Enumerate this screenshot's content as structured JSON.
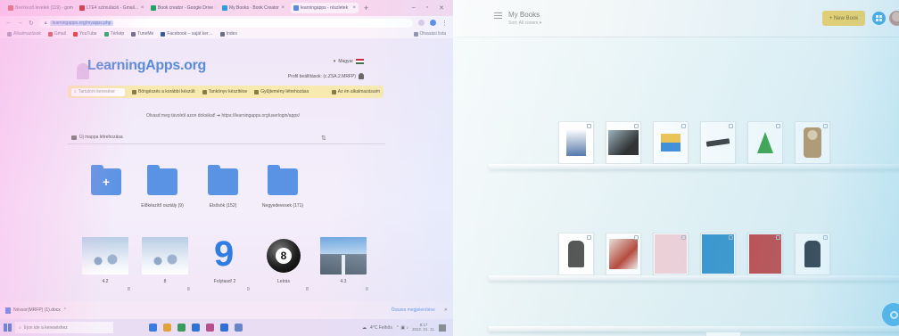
{
  "browser": {
    "tabs": [
      {
        "label": "Beérkező levelek (119) - gom…",
        "favicon_color": "#d44638",
        "active": false
      },
      {
        "label": "LTE4 szimuláció - Gmail…",
        "favicon_color": "#c5221f",
        "active": false
      },
      {
        "label": "Book creator - Google Drive",
        "favicon_color": "#1fa463",
        "active": false
      },
      {
        "label": "My Books · Book Creator",
        "favicon_color": "#2d9de0",
        "active": false
      },
      {
        "label": "learningapps - részletek",
        "favicon_color": "#5a8bd8",
        "active": true
      }
    ],
    "new_tab": "+",
    "window_controls": [
      "–",
      "▫",
      "✕"
    ],
    "url": "learningapps.org/myapps.php",
    "bookmarks": [
      {
        "label": "Alkalmazások",
        "color": "#8a8aa6"
      },
      {
        "label": "Gmail",
        "color": "#d44638"
      },
      {
        "label": "YouTube",
        "color": "#e62117"
      },
      {
        "label": "Térkép",
        "color": "#1fa463"
      },
      {
        "label": "TuneMe",
        "color": "#6d6d8c"
      },
      {
        "label": "Facebook – saját ker…",
        "color": "#3b5998"
      },
      {
        "label": "Index",
        "color": "#6d6d8c"
      }
    ],
    "bookmarks_right": "Olvasási lista"
  },
  "site": {
    "logo": "LearningApps.org",
    "language": "Magyar",
    "username": "Profil beállítások: (c.ZSA.2.MRFP)",
    "search_placeholder": "Tartalom keresése",
    "nav": [
      "Böngészés a korábbi készült",
      "Tankönyv készítése",
      "Gyűjtemény létrehozása"
    ],
    "nav_right": "Az én alkalmazásaim",
    "notice": "Olvasd meg távolról azon doksikat! ➔ https://learningapps.org/userlogin/apps/",
    "new_folder": "Új mappa létrehozása",
    "sort_icon": "⇅",
    "folders": [
      {
        "label": "",
        "plus": "+"
      },
      {
        "label": "Előkészítő osztály (9)",
        "plus": ""
      },
      {
        "label": "Elsősök (152)",
        "plus": ""
      },
      {
        "label": "Negyedevesek (171)",
        "plus": ""
      }
    ],
    "apps": [
      {
        "label": "4.2",
        "count": "8"
      },
      {
        "label": "8",
        "count": "8"
      },
      {
        "label": "Folytasd! 2",
        "count": "9",
        "number": "9"
      },
      {
        "label": "Leírás",
        "count": "8",
        "number": "8"
      },
      {
        "label": "4.3",
        "count": "8"
      }
    ]
  },
  "downloads": {
    "file": "Névsor(MRFP) (1).docx",
    "show_all": "Összes megjelenítése"
  },
  "taskbar": {
    "search_placeholder": "Írjon ide a kereséshez",
    "weather": "4°C Felhős",
    "time": "8:17",
    "date": "2022. 01. 11."
  },
  "bookcreator": {
    "title": "My Books",
    "subtitle": "Sort: All covers ▾",
    "new_book": "+ New Book",
    "shelves": [
      {
        "books": [
          {
            "cover": "soccer",
            "colors": [
              "#ffffff",
              "#5577aa"
            ]
          },
          {
            "cover": "screen",
            "colors": [
              "#9fb4be",
              "#2b2b2b"
            ]
          },
          {
            "cover": "cartoon",
            "colors": [
              "#f1c24a",
              "#3b8ad8"
            ]
          },
          {
            "cover": "gun",
            "colors": [
              "#ffffff",
              "#333333"
            ]
          },
          {
            "cover": "tree",
            "colors": [
              "#ffffff",
              "#2f9d3a"
            ]
          },
          {
            "cover": "woman",
            "colors": [
              "#ffffff",
              "#b68a55"
            ]
          }
        ]
      },
      {
        "books": [
          {
            "cover": "coat",
            "colors": [
              "#ffffff",
              "#555555"
            ]
          },
          {
            "cover": "collage",
            "colors": [
              "#e9e1d8",
              "#b84233"
            ]
          },
          {
            "cover": "pink",
            "colors": [
              "#f5d0d6",
              "#f5d0d6"
            ]
          },
          {
            "cover": "blue",
            "colors": [
              "#2c8ec9",
              "#2c8ec9"
            ]
          },
          {
            "cover": "red",
            "colors": [
              "#c03838",
              "#c03838"
            ]
          },
          {
            "cover": "dress",
            "colors": [
              "#ffffff",
              "#1e2430"
            ]
          }
        ]
      }
    ]
  }
}
